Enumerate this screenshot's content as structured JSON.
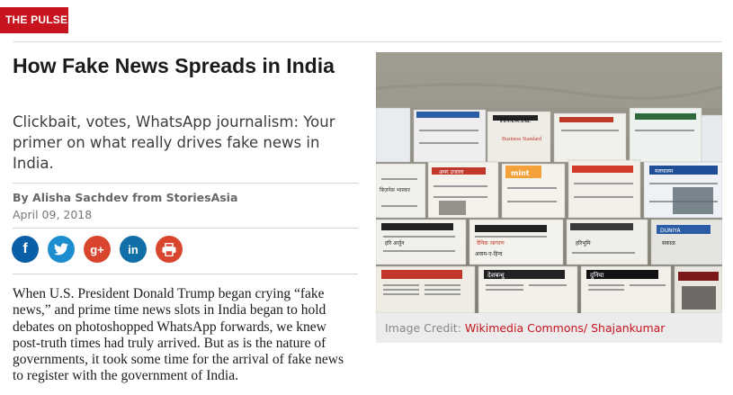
{
  "section": {
    "tag": "THE PULSE"
  },
  "article": {
    "headline": "How Fake News Spreads in India",
    "dek": "Clickbait, votes, WhatsApp journalism: Your primer on what really drives fake news in India.",
    "byline": "By Alisha Sachdev from StoriesAsia",
    "date": "April 09, 2018",
    "body": "When U.S. President Donald Trump began crying “fake news,” and prime time news slots in India began to hold debates on photoshopped WhatsApp forwards, we knew post-truth times had truly arrived. But as is the nature of governments, it took some time for the arrival of fake news to register with the government of India."
  },
  "share": {
    "buttons": [
      {
        "icon": "facebook-icon",
        "glyph": "f"
      },
      {
        "icon": "twitter-icon",
        "glyph": "t"
      },
      {
        "icon": "google-plus-icon",
        "glyph": "g+"
      },
      {
        "icon": "linkedin-icon",
        "glyph": "in"
      },
      {
        "icon": "print-icon",
        "glyph": ""
      }
    ]
  },
  "image": {
    "credit_label": "Image Credit:",
    "credit_link": "Wikimedia Commons/ Shajankumar",
    "newspaper_mastheads": [
      "FINANCIAL",
      "Business Standard",
      "अमर उजाला",
      "बिज़नेस भास्कर",
      "mint",
      "हरिभूमि",
      "दैनिक जागरण",
      "अवाम-ए-हिन्द",
      "देशबन्धु",
      "सकाळ",
      "DUNIYA",
      "दुनिया",
      "हरि अर्जुन",
      "मलयालम",
      "ONE INDIA"
    ]
  },
  "colors": {
    "brand_red": "#c8141e",
    "facebook": "#0a5ea8",
    "twitter": "#1c8ed0",
    "google_plus": "#d9452d",
    "linkedin": "#0f6fa6",
    "print": "#d9452d"
  }
}
